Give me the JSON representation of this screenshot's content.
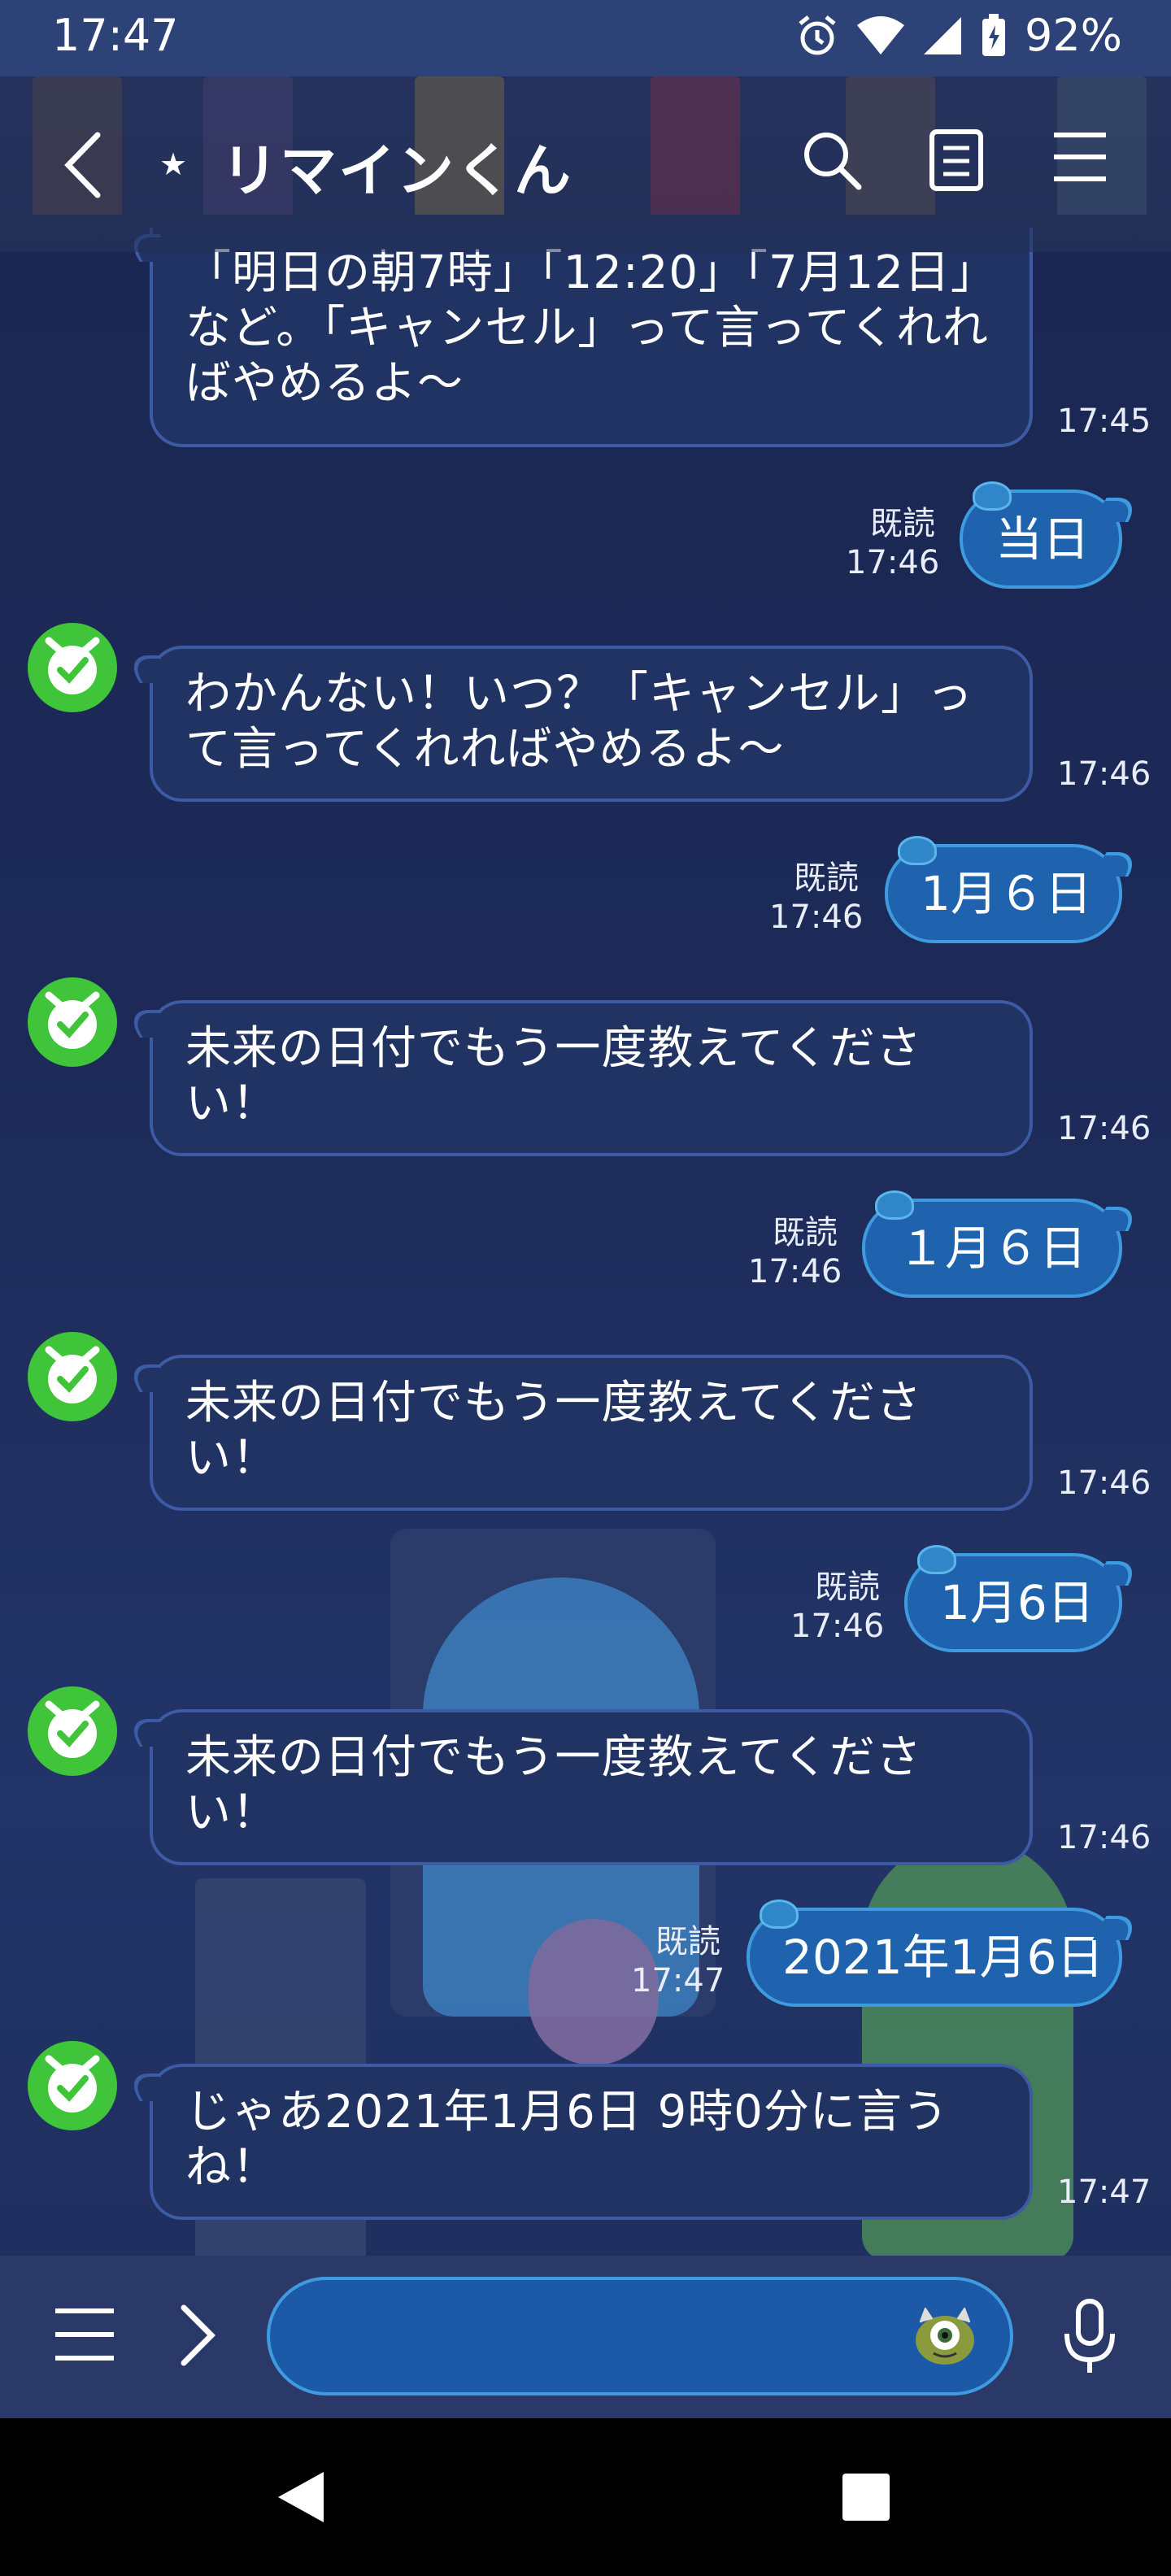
{
  "status_bar": {
    "time": "17:47",
    "battery": "92%"
  },
  "header": {
    "title": "リマインくん",
    "star": "★"
  },
  "read_label": "既読",
  "messages": [
    {
      "side": "in",
      "text": "「明日の朝7時」「12:20」「7月12日」など。「キャンセル」って言ってくれればやめるよ〜",
      "time": "17:45"
    },
    {
      "side": "out",
      "text": "当日",
      "time": "17:46"
    },
    {
      "side": "in",
      "text": "わかんない！いつ？「キャンセル」って言ってくれればやめるよ〜",
      "time": "17:46"
    },
    {
      "side": "out",
      "text": "1月６日",
      "time": "17:46"
    },
    {
      "side": "in",
      "text": "未来の日付でもう一度教えてください！",
      "time": "17:46"
    },
    {
      "side": "out",
      "text": "１月６日",
      "time": "17:46"
    },
    {
      "side": "in",
      "text": "未来の日付でもう一度教えてください！",
      "time": "17:46"
    },
    {
      "side": "out",
      "text": "1月6日",
      "time": "17:46"
    },
    {
      "side": "in",
      "text": "未来の日付でもう一度教えてください！",
      "time": "17:46"
    },
    {
      "side": "out",
      "text": "2021年1月6日",
      "time": "17:47"
    },
    {
      "side": "in",
      "text": "じゃあ2021年1月6日 9時0分に言うね！",
      "time": "17:47"
    }
  ],
  "input": {
    "placeholder": ""
  },
  "icons": {
    "back": "back-arrow-icon",
    "search": "search-icon",
    "notes": "notes-icon",
    "menu": "menu-icon",
    "avatar": "bot-avatar-icon",
    "list": "list-menu-icon",
    "expand": "expand-arrow-icon",
    "sticker": "monster-sticker-icon",
    "mic": "mic-icon"
  },
  "colors": {
    "bubble_in": "#203363",
    "bubble_out": "#1f62ae",
    "avatar_green": "#3fc43a"
  }
}
